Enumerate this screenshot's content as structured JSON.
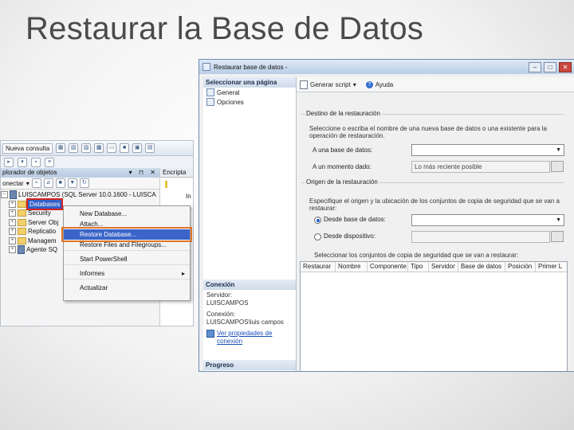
{
  "slide": {
    "title": "Restaurar la Base de Datos"
  },
  "ssms": {
    "toolbar": {
      "new_query": "Nueva consulta"
    },
    "explorer_title": "Explorador de objetos",
    "explorer_title_visible": "plorador de objetos",
    "connect_label": "Conectar",
    "connect_visible": "onectar",
    "side_tab": "Encripta",
    "side_in_1": "In",
    "side_in_2": "In",
    "tree": {
      "server": "LUISCAMPOS (SQL Server 10.0.1600 - LUISCA",
      "items": [
        "Databases",
        "Security",
        "Server Obj",
        "Replicatio",
        "Managem",
        "Agente SQ"
      ]
    },
    "context_menu": {
      "items": [
        {
          "label": "New Database..."
        },
        {
          "label": "Attach..."
        },
        {
          "label": "Restore Database..."
        },
        {
          "label": "Restore Files and Filegroups..."
        },
        {
          "label": "Start PowerShell"
        },
        {
          "label": "Informes"
        },
        {
          "label": "Actualizar"
        }
      ]
    }
  },
  "dialog": {
    "title": "Restaurar base de datos -",
    "sidebar": {
      "select_page": "Seleccionar una página",
      "pages": [
        "General",
        "Opciones"
      ],
      "connection_head": "Conexión",
      "server_label": "Servidor:",
      "server_value": "LUISCAMPOS",
      "connection_label": "Conexión:",
      "connection_value": "LUISCAMPOS\\luis campos",
      "view_props_link": "Ver propiedades de conexión",
      "progress_head": "Progreso"
    },
    "toolbar": {
      "script": "Generar script",
      "help": "Ayuda"
    },
    "destination": {
      "group": "Destino de la restauración",
      "desc": "Seleccione o escriba el nombre de una nueva base de datos o una existente para la operación de restauración.",
      "to_db_label": "A una base de datos:",
      "to_db_value": "",
      "point_label": "A un momento dado:",
      "point_value": "Lo más reciente posible"
    },
    "source": {
      "group": "Origen de la restauración",
      "desc": "Especifique el origen y la ubicación de los conjuntos de copia de seguridad que se van a restaurar:",
      "from_db": "Desde base de datos:",
      "from_device": "Desde dispositivo:",
      "select_sets": "Seleccionar los conjuntos de copia de seguridad que se van a restaurar:",
      "columns": [
        "Restaurar",
        "Nombre",
        "Componente",
        "Tipo",
        "Servidor",
        "Base de datos",
        "Posición",
        "Primer L"
      ]
    }
  }
}
